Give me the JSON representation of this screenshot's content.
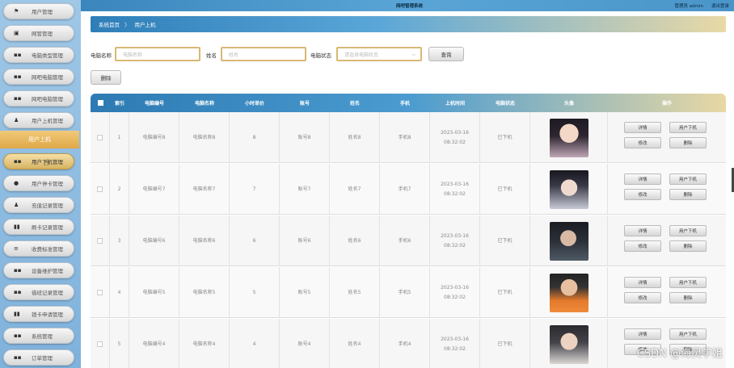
{
  "topbar": {
    "title": "网吧管理系统",
    "admin": "管理员 admin",
    "logout": "退出登录"
  },
  "sidebar": {
    "items": [
      {
        "label": "用户管理",
        "icon": "flag-icon",
        "glyph": "⚑"
      },
      {
        "label": "网管管理",
        "icon": "clipboard-icon",
        "glyph": "▣"
      },
      {
        "label": "电脑类型管理",
        "icon": "grid-icon",
        "glyph": "▪▪"
      },
      {
        "label": "网吧电脑管理",
        "icon": "grid-icon",
        "glyph": "▪▪"
      },
      {
        "label": "网吧电脑管理",
        "icon": "grid-icon",
        "glyph": "▪▪"
      },
      {
        "label": "用户上机管理",
        "icon": "user-icon",
        "glyph": "♟"
      }
    ],
    "section": "用户上机",
    "sub_items": [
      {
        "label": "用户下机管理",
        "icon": "grid-icon",
        "glyph": "▪▪"
      },
      {
        "label": "用户停卡管理",
        "icon": "location-icon",
        "glyph": "●"
      },
      {
        "label": "充值记录管理",
        "icon": "user-icon",
        "glyph": "♟"
      },
      {
        "label": "刷卡记录管理",
        "icon": "bar-chart-icon",
        "glyph": "▮▮"
      },
      {
        "label": "收费标准管理",
        "icon": "sliders-icon",
        "glyph": "≡"
      },
      {
        "label": "设备维护管理",
        "icon": "grid-icon",
        "glyph": "▪▪"
      },
      {
        "label": "借班记录管理",
        "icon": "grid-icon",
        "glyph": "▪▪"
      },
      {
        "label": "销卡申请管理",
        "icon": "chart-icon",
        "glyph": "▮▮"
      },
      {
        "label": "系统管理",
        "icon": "grid-icon",
        "glyph": "▪▪"
      },
      {
        "label": "订单管理",
        "icon": "grid-icon",
        "glyph": "▪▪"
      }
    ]
  },
  "breadcrumb": {
    "home": "系统首页",
    "sep": "〉",
    "current": "用户上机"
  },
  "search": {
    "computer_name_label": "电脑名称",
    "computer_name_placeholder": "电脑名称",
    "name_label": "姓名",
    "name_placeholder": "姓名",
    "status_label": "电脑状态",
    "status_placeholder": "请选择电脑状态",
    "query_button": "查询"
  },
  "delete_button": "删除",
  "table": {
    "headers": [
      "索引",
      "电脑编号",
      "电脑名称",
      "小时单价",
      "账号",
      "姓名",
      "手机",
      "上机时间",
      "电脑状态",
      "头像",
      "操作"
    ],
    "rows": [
      {
        "index": "1",
        "code": "电脑编号8",
        "name": "电脑名称8",
        "price": "8",
        "account": "账号8",
        "person": "姓名8",
        "phone": "手机8",
        "time": "2023-03-16 08:32:02",
        "status": "已下机"
      },
      {
        "index": "2",
        "code": "电脑编号7",
        "name": "电脑名称7",
        "price": "7",
        "account": "账号7",
        "person": "姓名7",
        "phone": "手机7",
        "time": "2023-03-16 08:32:02",
        "status": "已下机"
      },
      {
        "index": "3",
        "code": "电脑编号6",
        "name": "电脑名称6",
        "price": "6",
        "account": "账号6",
        "person": "姓名6",
        "phone": "手机6",
        "time": "2023-03-16 08:32:02",
        "status": "已下机"
      },
      {
        "index": "4",
        "code": "电脑编号5",
        "name": "电脑名称5",
        "price": "5",
        "account": "账号5",
        "person": "姓名5",
        "phone": "手机5",
        "time": "2023-03-16 08:32:02",
        "status": "已下机"
      },
      {
        "index": "5",
        "code": "电脑编号4",
        "name": "电脑名称4",
        "price": "4",
        "account": "账号4",
        "person": "姓名4",
        "phone": "手机4",
        "time": "2023-03-16 08:32:02",
        "status": "已下机"
      }
    ],
    "actions": {
      "detail": "详情",
      "logout": "用户下机",
      "edit": "修改",
      "delete": "删除"
    }
  },
  "watermark": "CSDN @海灵学姐"
}
